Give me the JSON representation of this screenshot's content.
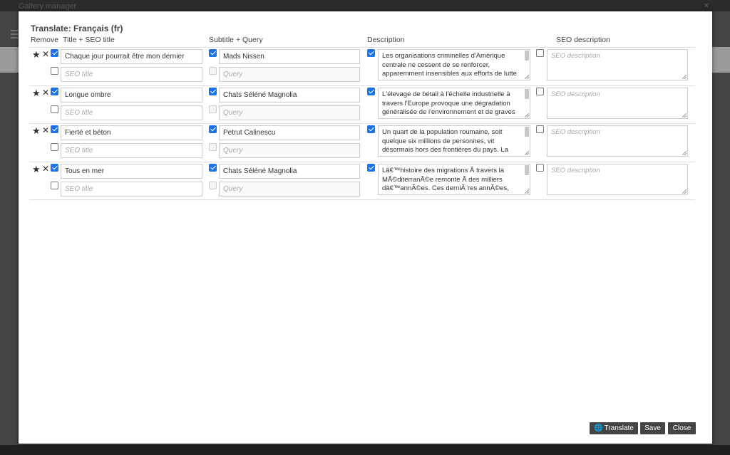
{
  "window": {
    "title": "Gallery manager",
    "close_glyph": "×"
  },
  "modal": {
    "title": "Translate: Français (fr)",
    "headers": {
      "remove": "Remove",
      "title_seo": "Title + SEO title",
      "subtitle_query": "Subtitle + Query",
      "description": "Description",
      "seo_description": "SEO description"
    },
    "rows": [
      {
        "title": "Chaque jour pourrait être mon dernier",
        "seo_title_placeholder": "SEO title",
        "subtitle": "Mads Nissen",
        "query_placeholder": "Query",
        "description": "Les organisations criminelles d'Amérique centrale ne cessent de se renforcer, apparemment insensibles aux efforts de lutte",
        "seo_description_placeholder": "SEO description",
        "title_checked": true,
        "seo_title_checked": false,
        "subtitle_checked": true,
        "query_checked": false,
        "description_checked": true,
        "seo_description_checked": false
      },
      {
        "title": "Longue ombre",
        "seo_title_placeholder": "SEO title",
        "subtitle": "Chats Séléné Magnolia",
        "query_placeholder": "Query",
        "description": "L'élevage de bétail à l'échelle industrielle à travers l'Europe provoque une dégradation généralisée de l'environnement et de graves",
        "seo_description_placeholder": "SEO description",
        "title_checked": true,
        "seo_title_checked": false,
        "subtitle_checked": true,
        "query_checked": false,
        "description_checked": true,
        "seo_description_checked": false
      },
      {
        "title": "Fierté et béton",
        "seo_title_placeholder": "SEO title",
        "subtitle": "Petrut Calinescu",
        "query_placeholder": "Query",
        "description": "Un quart de la population roumaine, soit quelque six millions de personnes, vit désormais hors des frontières du pays. La",
        "seo_description_placeholder": "SEO description",
        "title_checked": true,
        "seo_title_checked": false,
        "subtitle_checked": true,
        "query_checked": false,
        "description_checked": true,
        "seo_description_checked": false
      },
      {
        "title": "Tous en mer",
        "seo_title_placeholder": "SEO title",
        "subtitle": "Chats Séléné Magnolia",
        "query_placeholder": "Query",
        "description": "Lâ€™histoire des migrations Ã  travers la MÃ©diterranÃ©e remonte Ã  des milliers dâ€™annÃ©es. Ces derniÃ¨res annÃ©es, des",
        "seo_description_placeholder": "SEO description",
        "title_checked": true,
        "seo_title_checked": false,
        "subtitle_checked": true,
        "query_checked": false,
        "description_checked": true,
        "seo_description_checked": false
      }
    ],
    "icons": {
      "star": "★",
      "remove": "✕",
      "globe": "🌐"
    },
    "buttons": {
      "translate": "Translate",
      "save": "Save",
      "close": "Close"
    }
  },
  "colors": {
    "checkbox_accent": "#1a73e8",
    "button_bg": "#444444"
  }
}
